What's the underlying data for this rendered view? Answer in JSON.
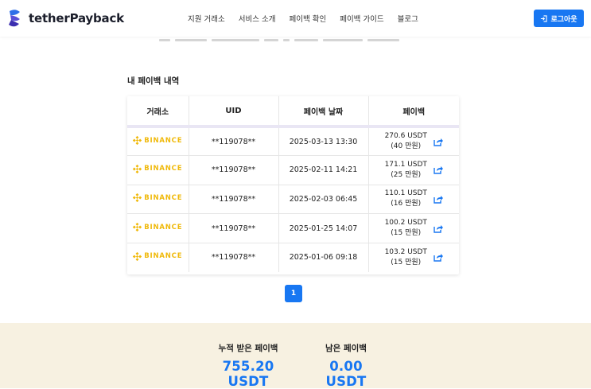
{
  "header": {
    "brand": "tetherPayback",
    "nav": [
      "지원 거래소",
      "서비스 소개",
      "페이백 확인",
      "페이백 가이드",
      "블로그"
    ],
    "logout_label": "로그아웃"
  },
  "section_title": "내 페이백 내역",
  "table": {
    "headers": [
      "거래소",
      "UID",
      "페이백 날짜",
      "페이백"
    ],
    "rows": [
      {
        "exchange": "BINANCE",
        "uid": "**119078**",
        "date": "2025-03-13 13:30",
        "amount": "270.6 USDT",
        "krw": "(40 만원)"
      },
      {
        "exchange": "BINANCE",
        "uid": "**119078**",
        "date": "2025-02-11 14:21",
        "amount": "171.1 USDT",
        "krw": "(25 만원)"
      },
      {
        "exchange": "BINANCE",
        "uid": "**119078**",
        "date": "2025-02-03 06:45",
        "amount": "110.1 USDT",
        "krw": "(16 만원)"
      },
      {
        "exchange": "BINANCE",
        "uid": "**119078**",
        "date": "2025-01-25 14:07",
        "amount": "100.2 USDT",
        "krw": "(15 만원)"
      },
      {
        "exchange": "BINANCE",
        "uid": "**119078**",
        "date": "2025-01-06 09:18",
        "amount": "103.2 USDT",
        "krw": "(15 만원)"
      }
    ]
  },
  "pagination": {
    "current": "1"
  },
  "summary": {
    "received_label": "누적 받은 페이백",
    "received_value": "755.20 USDT",
    "remaining_label": "남은 페이백",
    "remaining_value": "0.00 USDT"
  },
  "colors": {
    "accent": "#1877f2",
    "binance": "#f0b90b",
    "summary_bg": "#f7f1e1"
  },
  "icons": {
    "logo": "tether-logo-icon",
    "logout": "logout-icon",
    "exchange": "binance-logo-icon",
    "detail": "share-icon"
  }
}
